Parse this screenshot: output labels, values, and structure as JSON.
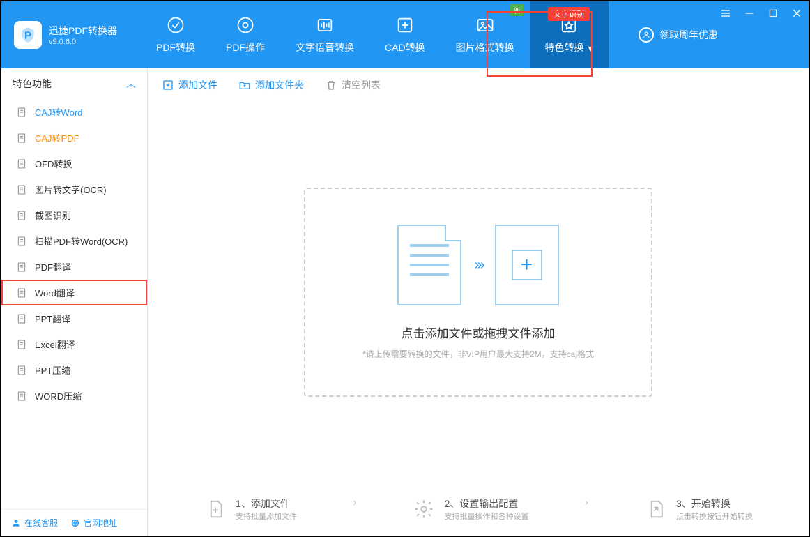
{
  "app": {
    "name": "迅捷PDF转换器",
    "version": "v9.0.6.0"
  },
  "nav": {
    "tabs": [
      {
        "label": "PDF转换"
      },
      {
        "label": "PDF操作"
      },
      {
        "label": "文字语音转换"
      },
      {
        "label": "CAD转换"
      },
      {
        "label": "图片格式转换",
        "badge_new": "新"
      },
      {
        "label": "特色转换",
        "badge_red": "文字识别"
      }
    ],
    "reward": "领取周年优惠"
  },
  "sidebar": {
    "header": "特色功能",
    "items": [
      {
        "label": "CAJ转Word",
        "style": "blue"
      },
      {
        "label": "CAJ转PDF",
        "style": "orange"
      },
      {
        "label": "OFD转换"
      },
      {
        "label": "图片转文字(OCR)"
      },
      {
        "label": "截图识别"
      },
      {
        "label": "扫描PDF转Word(OCR)"
      },
      {
        "label": "PDF翻译"
      },
      {
        "label": "Word翻译",
        "highlighted": true
      },
      {
        "label": "PPT翻译"
      },
      {
        "label": "Excel翻译"
      },
      {
        "label": "PPT压缩"
      },
      {
        "label": "WORD压缩"
      }
    ],
    "footer": {
      "service": "在线客服",
      "site": "官网地址"
    }
  },
  "toolbar": {
    "add_file": "添加文件",
    "add_folder": "添加文件夹",
    "clear_list": "清空列表"
  },
  "drop": {
    "title": "点击添加文件或拖拽文件添加",
    "subtitle": "*请上传需要转换的文件，非VIP用户最大支持2M，支持caj格式"
  },
  "steps": [
    {
      "title": "1、添加文件",
      "sub": "支持批量添加文件"
    },
    {
      "title": "2、设置输出配置",
      "sub": "支持批量操作和各种设置"
    },
    {
      "title": "3、开始转换",
      "sub": "点击转换按钮开始转换"
    }
  ]
}
